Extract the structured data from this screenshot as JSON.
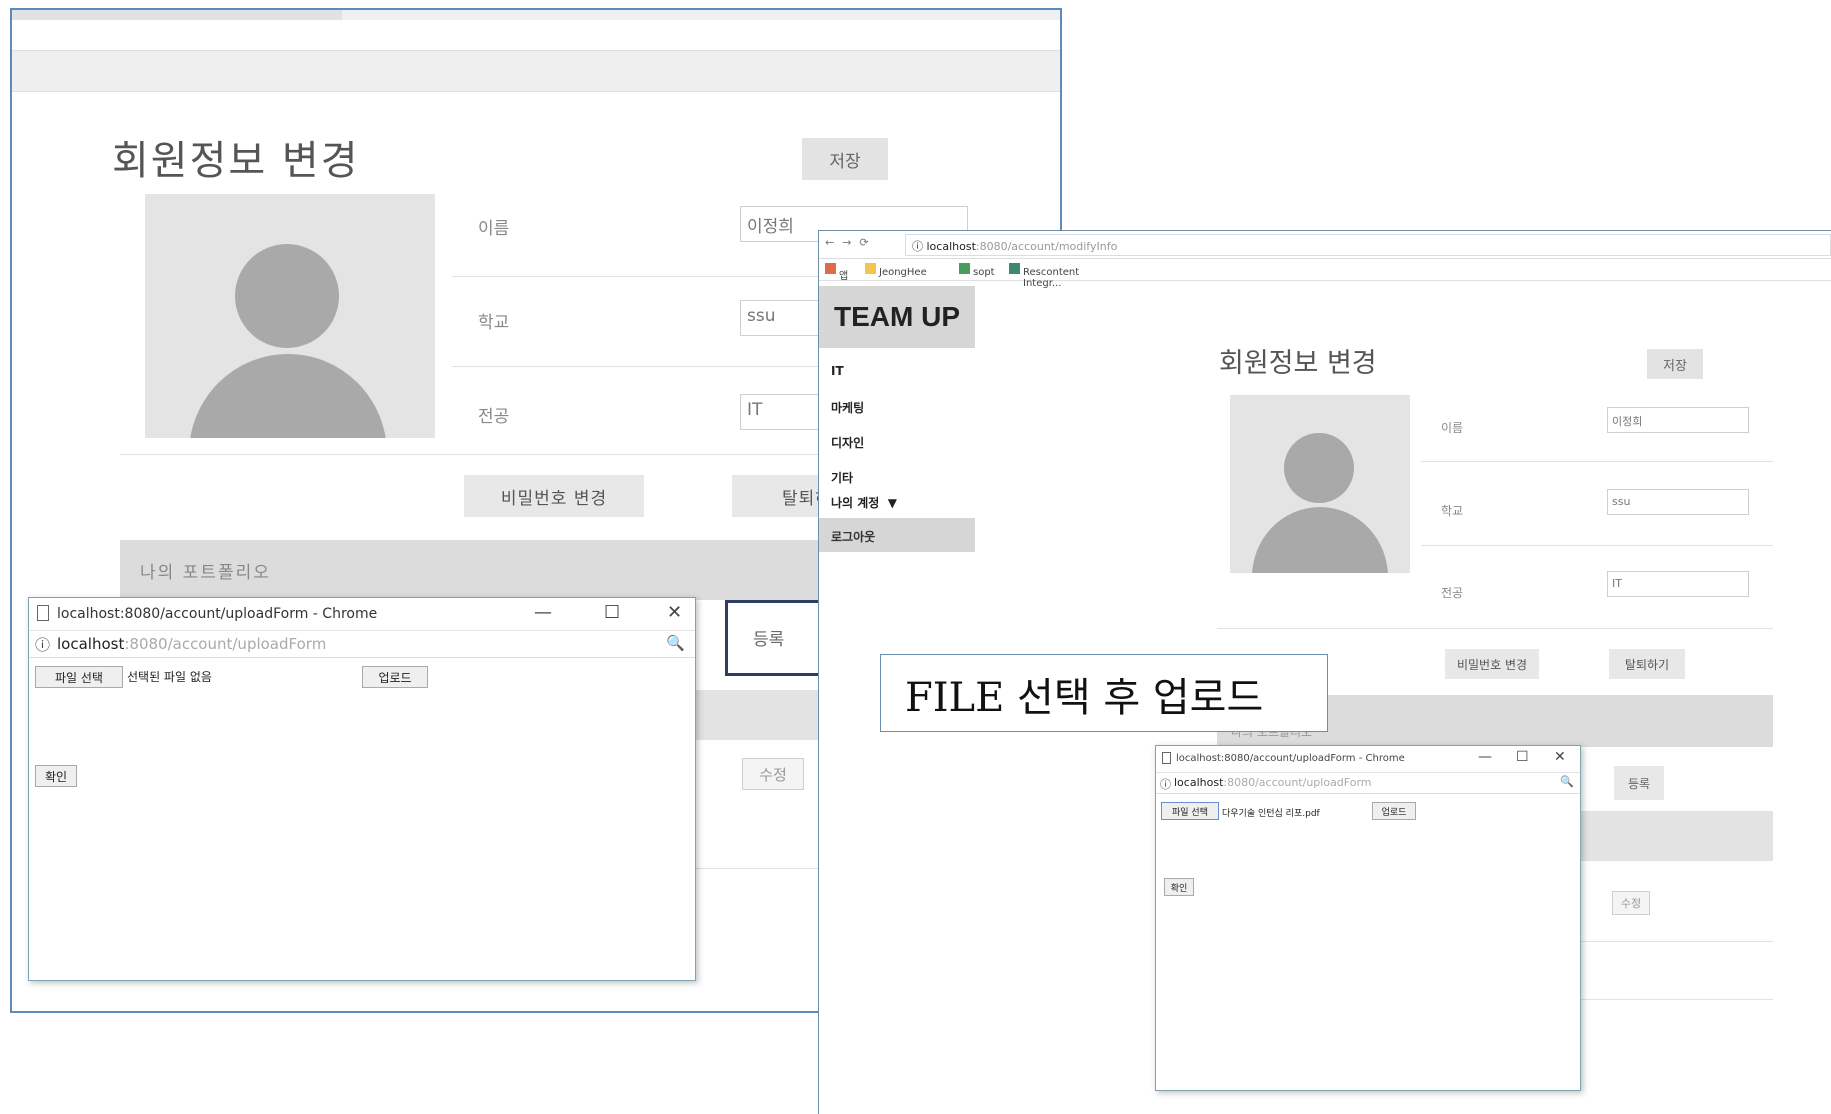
{
  "left_screen": {
    "page_title": "회원정보 변경",
    "save_label": "저장",
    "fields": [
      {
        "label": "이름",
        "value": "이정희"
      },
      {
        "label": "학교",
        "value": "ssu"
      },
      {
        "label": "전공",
        "value": "IT"
      }
    ],
    "change_password_label": "비밀번호 변경",
    "withdraw_label": "탈퇴하",
    "portfolio_title": "나의 포트폴리오",
    "register_label": "등록",
    "edit_label": "수정"
  },
  "left_popup": {
    "window_title": "localhost:8080/account/uploadForm - Chrome",
    "url_host": "localhost",
    "url_path": ":8080/account/uploadForm",
    "choose_file_label": "파일 선택",
    "no_file_text": "선택된 파일 없음",
    "upload_label": "업로드",
    "confirm_label": "확인",
    "window_controls": [
      "—",
      "☐",
      "✕"
    ]
  },
  "right_screen": {
    "url_host": "localhost",
    "url_path": ":8080/account/modifyInfo",
    "bookmarks": [
      "앱",
      "JeongHee",
      "sopt",
      "Rescontent Integr..."
    ],
    "logo": "TEAM UP",
    "menu": [
      "IT",
      "마케팅",
      "디자인",
      "기타",
      "나의 계정  ▼"
    ],
    "logout_label": "로그아웃",
    "page_title": "회원정보 변경",
    "save_label": "저장",
    "fields": [
      {
        "label": "이름",
        "value": "이정희"
      },
      {
        "label": "학교",
        "value": "ssu"
      },
      {
        "label": "전공",
        "value": "IT"
      }
    ],
    "change_password_label": "비밀번호 변경",
    "withdraw_label": "탈퇴하기",
    "portfolio_title": "나의 포트폴리오",
    "register_label": "등록",
    "edit_label": "수정"
  },
  "right_popup": {
    "window_title": "localhost:8080/account/uploadForm - Chrome",
    "url_host": "localhost",
    "url_path": ":8080/account/uploadForm",
    "choose_file_label": "파일 선택",
    "chosen_file_text": "다우기술 인턴십 리포.pdf",
    "upload_label": "업로드",
    "confirm_label": "확인",
    "window_controls": [
      "—",
      "☐",
      "✕"
    ]
  },
  "annotation": "FILE 선택 후 업로드",
  "colors": {
    "accent_border": "#2f3d63",
    "gray_panel": "#dcdcdc",
    "avatar_fg": "#a9a9a9"
  }
}
